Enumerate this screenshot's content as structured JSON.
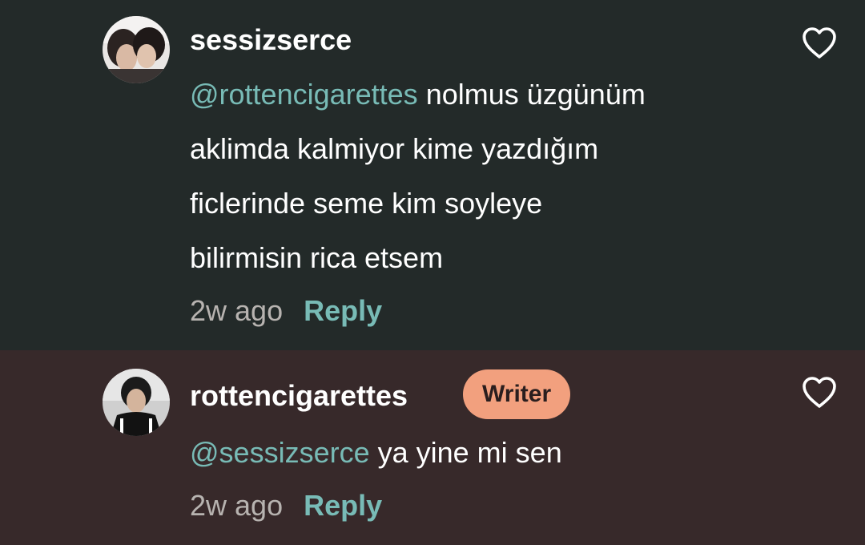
{
  "comments": [
    {
      "username": "sessizserce",
      "mention": "@rottencigarettes",
      "lines": [
        " nolmus üzgünüm",
        "aklimda kalmiyor kime yazdığım",
        "ficlerinde seme kim soyleye",
        "bilirmisin rica etsem"
      ],
      "timestamp": "2w ago",
      "reply_label": "Reply",
      "avatar_icon": "profile-photo"
    },
    {
      "username": "rottencigarettes",
      "badge": "Writer",
      "mention": "@sessizserce",
      "text": " ya yine mi sen",
      "timestamp": "2w ago",
      "reply_label": "Reply",
      "avatar_icon": "profile-photo"
    }
  ],
  "colors": {
    "comment_bg": "#232a29",
    "writer_comment_bg": "#37292a",
    "mention": "#78bbb6",
    "reply": "#78bbb6",
    "badge_bg": "#f2a07e",
    "timestamp": "#b7b3b0",
    "text": "#ffffff"
  },
  "icons": {
    "like": "heart-outline-icon"
  }
}
